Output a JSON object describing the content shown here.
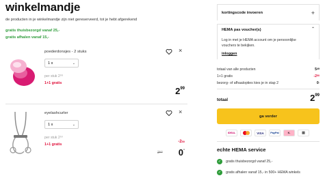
{
  "page": {
    "title": "winkelmandje",
    "intro": "de producten in je winkelmandje zijn niet gereserveerd, tot je hebt afgerekend",
    "promos": [
      "gratis thuisbezorgd vanaf 25,-",
      "gratis afhalen vanaf 15,-"
    ]
  },
  "products": [
    {
      "name": "poederdonsjes - 2 stuks",
      "qty": "1 x",
      "unit_price": "per stuk 2⁹⁹",
      "deal": "1+1 gratis",
      "price_main": "2",
      "price_cents": "99",
      "image": "powder-puff-icon"
    },
    {
      "name": "eyelashcurler",
      "qty": "1 x",
      "unit_price": "per stuk 2⁵⁰",
      "deal": "1+1 gratis",
      "discount_main": "-2",
      "discount_cents": "50",
      "old_price": "2⁵⁰",
      "price_main": "0",
      "price_cents": "-",
      "image": "eyelash-curler-icon"
    }
  ],
  "sidebar": {
    "coupon_label": "kortingscode invoeren",
    "voucher": {
      "title": "HEMA pas voucher(s)",
      "text": "Log in met je HEMA account om je persoonlijke vouchers te bekijken.",
      "login": "inloggen"
    },
    "totals": [
      {
        "label": "totaal van alle producten",
        "main": "5",
        "cents": "49",
        "red": false
      },
      {
        "label": "1+1 gratis",
        "main": "-2",
        "cents": "50",
        "red": true
      },
      {
        "label": "bezorg- of afhaalopties kies je in stap 2",
        "main": "0",
        "cents": "-",
        "red": false
      }
    ],
    "total_label": "totaal",
    "total_main": "2",
    "total_cents": "99",
    "cta": "ga verder",
    "payments": [
      "iDEAL",
      "mastercard",
      "VISA",
      "PayPal",
      "Klarna",
      "gift"
    ],
    "service": {
      "title": "echte HEMA service",
      "items": [
        "gratis thuisbezorgd vanaf 25,-",
        "gratis afhalen vanaf 15,- in 500+ HEMA winkels"
      ]
    }
  },
  "colors": {
    "accent_yellow": "#f7c31c",
    "deal_red": "#e0103a",
    "success_green": "#2e9c3a"
  }
}
